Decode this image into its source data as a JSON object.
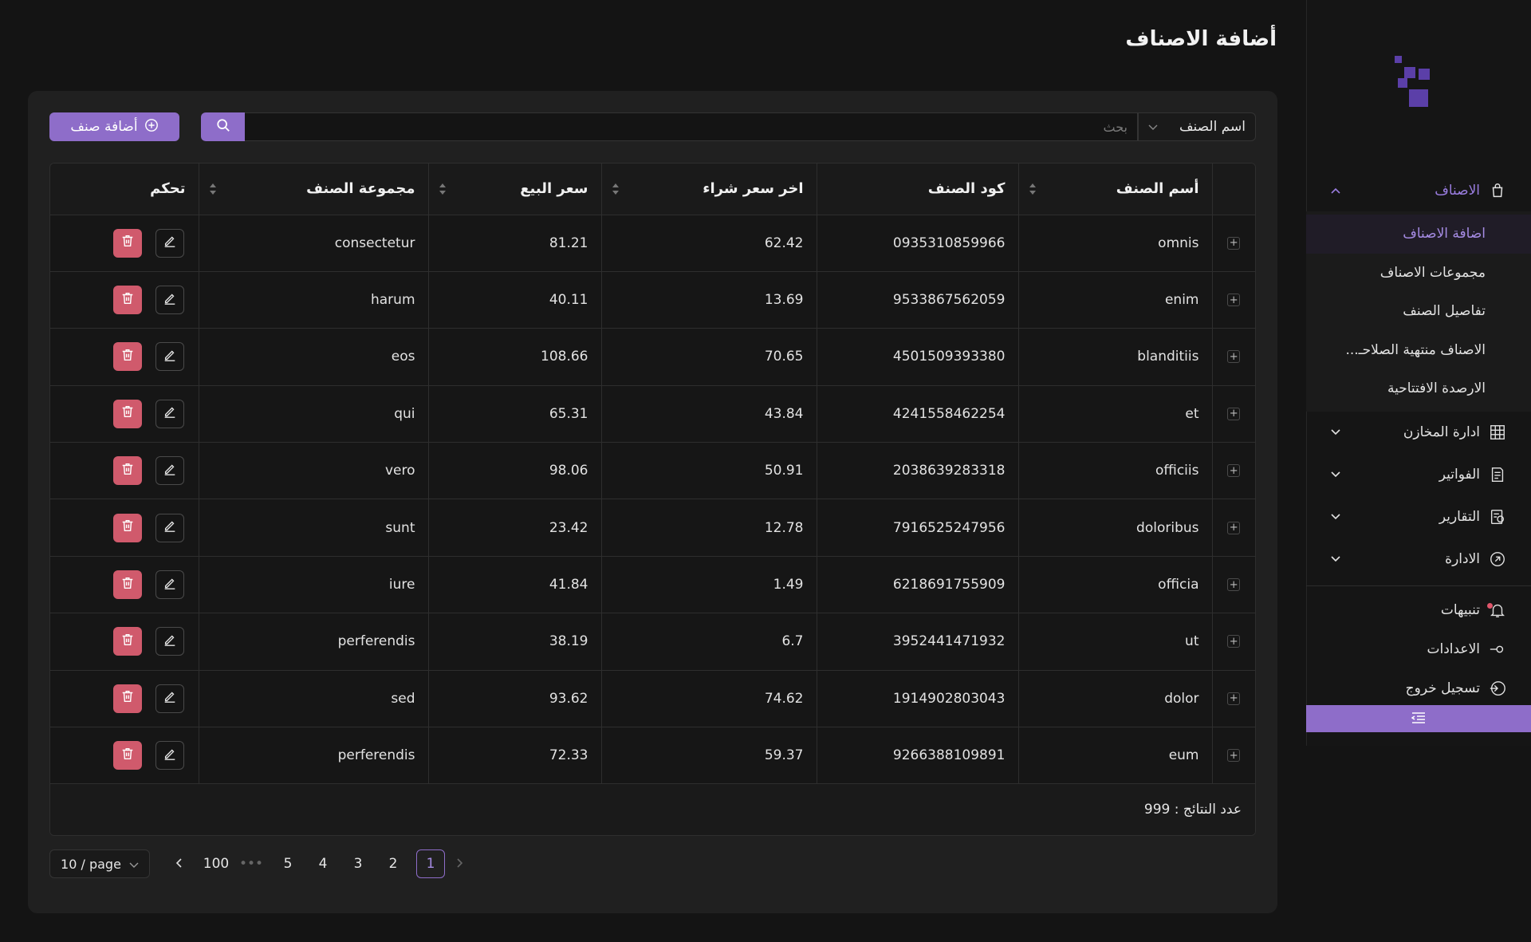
{
  "page": {
    "title": "أضافة الاصناف"
  },
  "sidebar": {
    "menu": [
      {
        "label": "الاصناف",
        "icon": "bag-icon",
        "expanded": true
      },
      {
        "label": "ادارة المخازن",
        "icon": "warehouse-icon"
      },
      {
        "label": "الفواتير",
        "icon": "invoice-icon"
      },
      {
        "label": "التقارير",
        "icon": "report-icon"
      },
      {
        "label": "الادارة",
        "icon": "admin-icon"
      }
    ],
    "submenu": [
      {
        "label": "اضافة الاصناف",
        "current": true
      },
      {
        "label": "مجموعات الاصناف"
      },
      {
        "label": "تفاصيل الصنف"
      },
      {
        "label": "الاصناف منتهية الصلاحـ..."
      },
      {
        "label": "الارصدة الافتتاحية"
      }
    ],
    "bottom": [
      {
        "label": "تنبيهات",
        "icon": "bell-icon"
      },
      {
        "label": "الاعدادات",
        "icon": "settings-icon"
      },
      {
        "label": "تسجيل خروج",
        "icon": "logout-icon"
      }
    ],
    "accent": "#8e6dc9"
  },
  "toolbar": {
    "add_label": "أضافة صنف",
    "search_placeholder": "بحث",
    "search_field": "اسم الصنف"
  },
  "table": {
    "headers": {
      "name": "أسم الصنف",
      "code": "كود الصنف",
      "last_price": "اخر سعر شراء",
      "sell_price": "سعر البيع",
      "group": "مجموعة الصنف",
      "control": "تحكم"
    },
    "rows": [
      {
        "name": "omnis",
        "code": "0935310859966",
        "last_price": "62.42",
        "sell_price": "81.21",
        "group": "consectetur"
      },
      {
        "name": "enim",
        "code": "9533867562059",
        "last_price": "13.69",
        "sell_price": "40.11",
        "group": "harum"
      },
      {
        "name": "blanditiis",
        "code": "4501509393380",
        "last_price": "70.65",
        "sell_price": "108.66",
        "group": "eos"
      },
      {
        "name": "et",
        "code": "4241558462254",
        "last_price": "43.84",
        "sell_price": "65.31",
        "group": "qui"
      },
      {
        "name": "officiis",
        "code": "2038639283318",
        "last_price": "50.91",
        "sell_price": "98.06",
        "group": "vero"
      },
      {
        "name": "doloribus",
        "code": "7916525247956",
        "last_price": "12.78",
        "sell_price": "23.42",
        "group": "sunt"
      },
      {
        "name": "officia",
        "code": "6218691755909",
        "last_price": "1.49",
        "sell_price": "41.84",
        "group": "iure"
      },
      {
        "name": "ut",
        "code": "3952441471932",
        "last_price": "6.7",
        "sell_price": "38.19",
        "group": "perferendis"
      },
      {
        "name": "dolor",
        "code": "1914902803043",
        "last_price": "74.62",
        "sell_price": "93.62",
        "group": "sed"
      },
      {
        "name": "eum",
        "code": "9266388109891",
        "last_price": "59.37",
        "sell_price": "72.33",
        "group": "perferendis"
      }
    ],
    "results_label": "عدد النتائج : 999"
  },
  "pagination": {
    "page_size": "10 / page",
    "pages": [
      "1",
      "2",
      "3",
      "4",
      "5"
    ],
    "ellipsis": "•••",
    "last": "100",
    "current": "1"
  }
}
